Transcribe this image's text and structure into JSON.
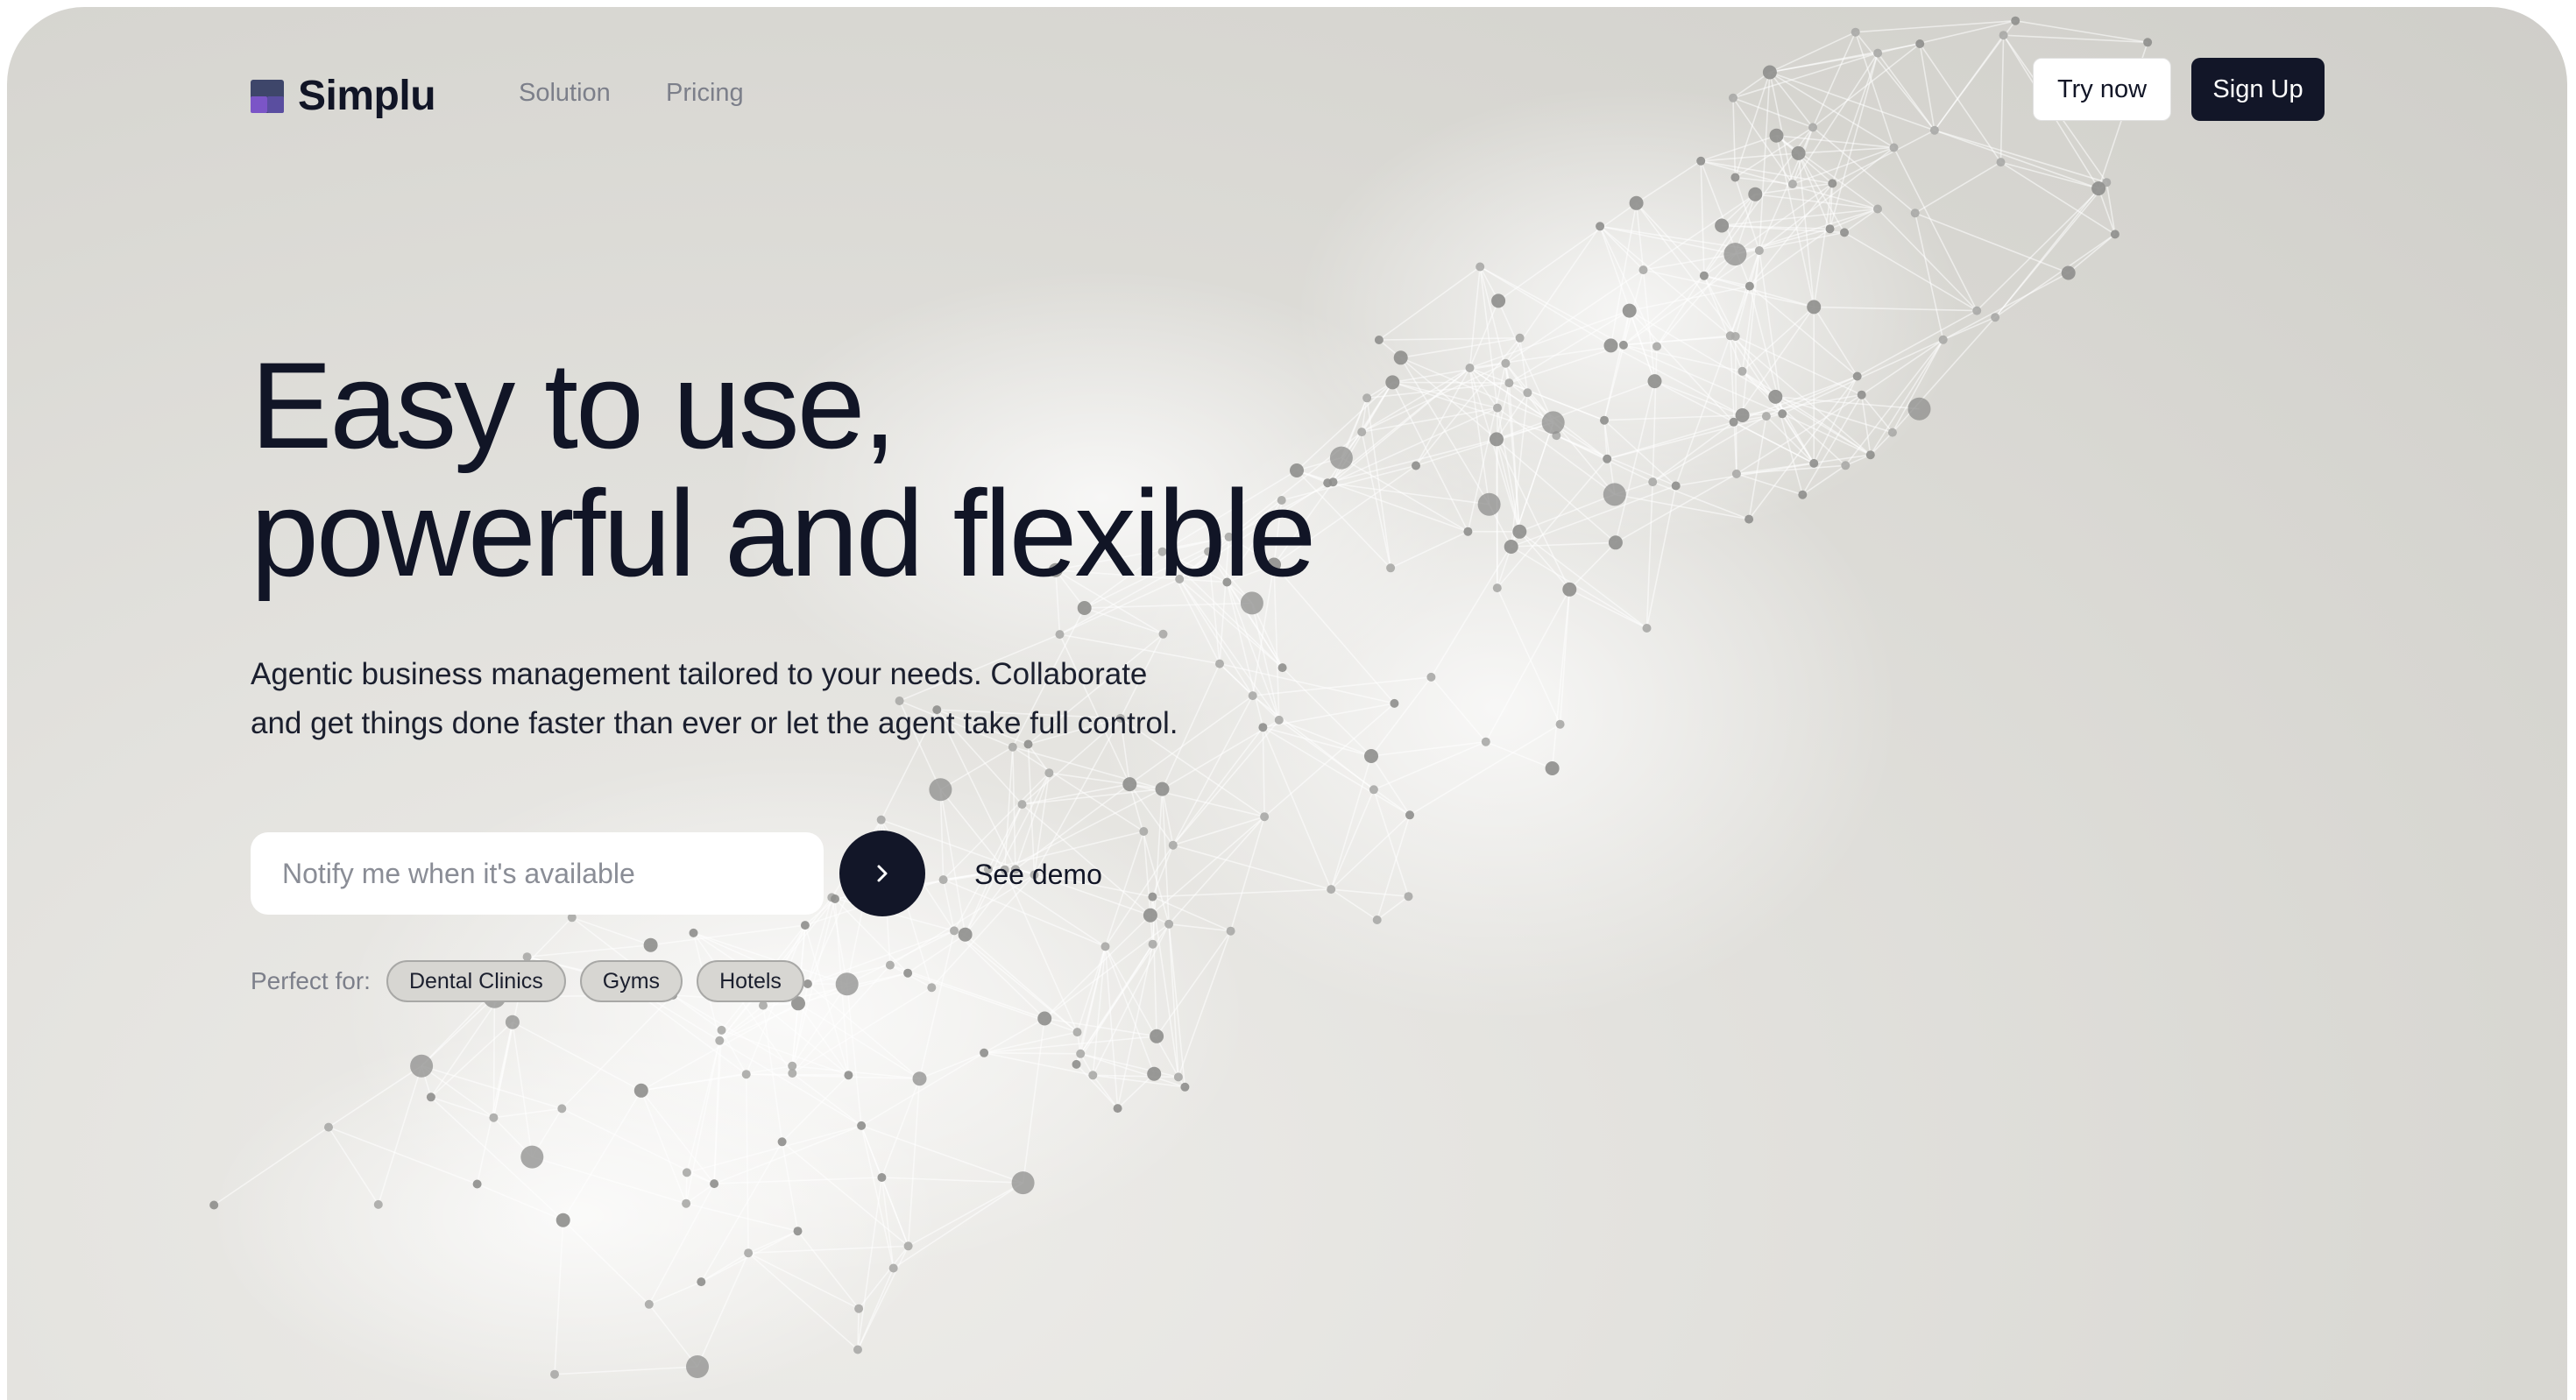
{
  "header": {
    "logo_text": "Simplu",
    "nav": {
      "solution": "Solution",
      "pricing": "Pricing"
    },
    "try_now": "Try now",
    "sign_up": "Sign Up"
  },
  "hero": {
    "headline_line1": "Easy to use,",
    "headline_line2": "powerful and flexible",
    "subtitle_line1": "Agentic business management tailored to your needs. Collaborate",
    "subtitle_line2": "and get things done faster than ever or let the agent take full control."
  },
  "notify": {
    "placeholder": "Notify me when it's available",
    "value": "",
    "submit_icon": "chevron-right-icon"
  },
  "see_demo": "See demo",
  "perfect_for": {
    "label": "Perfect for:",
    "chips": [
      "Dental Clinics",
      "Gyms",
      "Hotels"
    ]
  },
  "colors": {
    "primary_dark": "#121628",
    "logo_slate": "#3e466a",
    "logo_purple": "#7b55c7",
    "background": "#e3e2de",
    "muted_text": "#7c7f8a"
  },
  "icons": {
    "logo": "simplu-logo-icon",
    "background": "network-graph-illustration"
  }
}
